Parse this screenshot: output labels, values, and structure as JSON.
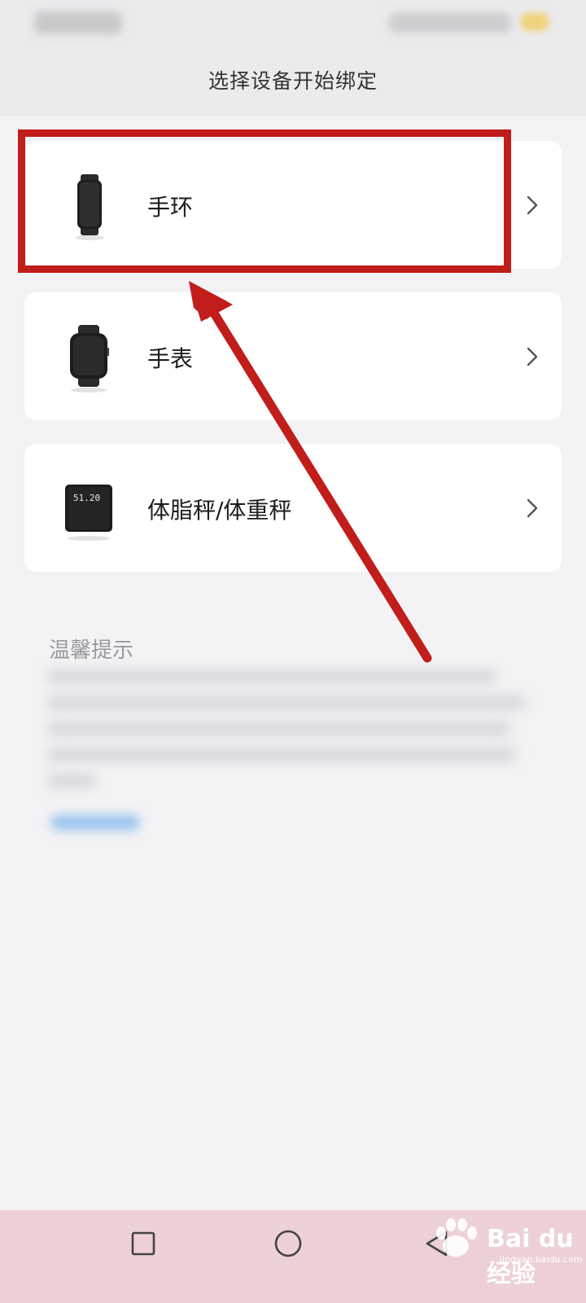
{
  "header": {
    "title": "选择设备开始绑定"
  },
  "devices": [
    {
      "label": "手环",
      "icon": "fitness-band-icon"
    },
    {
      "label": "手表",
      "icon": "smartwatch-icon"
    },
    {
      "label": "体脂秤/体重秤",
      "icon": "body-scale-icon",
      "scale_reading": "51.20"
    }
  ],
  "tips": {
    "title": "温馨提示"
  },
  "annotation": {
    "color": "#c11d1a"
  },
  "watermark": {
    "text": "Bai du 经验",
    "sub": "jingyan.baidu.com"
  }
}
